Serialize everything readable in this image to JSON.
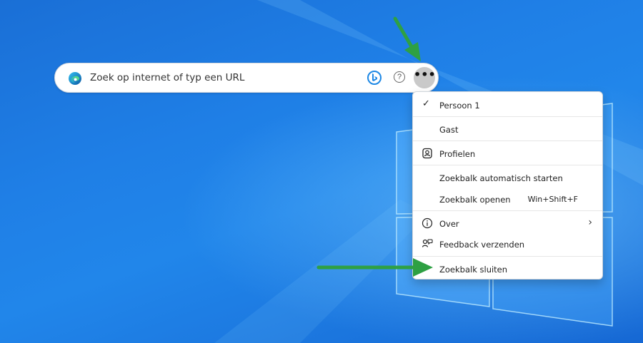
{
  "searchbar": {
    "placeholder": "Zoek op internet of typ een URL",
    "icons": {
      "browser": "edge-icon",
      "bing": "bing-icon",
      "help": "help-icon",
      "more": "more-icon"
    },
    "help_glyph": "?",
    "more_glyph": "•••"
  },
  "menu": {
    "check_glyph": "✓",
    "items": [
      {
        "label": "Persoon 1",
        "checked": true
      },
      {
        "label": "Gast"
      },
      {
        "label": "Profielen",
        "icon": "profile-icon"
      },
      {
        "label": "Zoekbalk automatisch starten"
      },
      {
        "label": "Zoekbalk openen",
        "shortcut": "Win+Shift+F"
      },
      {
        "label": "Over",
        "icon": "info-icon",
        "has_submenu": true,
        "chevron_glyph": "›"
      },
      {
        "label": "Feedback verzenden",
        "icon": "feedback-icon"
      },
      {
        "label": "Zoekbalk sluiten"
      }
    ]
  },
  "colors": {
    "desktop_blue": "#1f7fe6",
    "arrow_green": "#2ea043",
    "menu_bg": "#ffffff",
    "more_button_bg": "#c9c9c9"
  }
}
